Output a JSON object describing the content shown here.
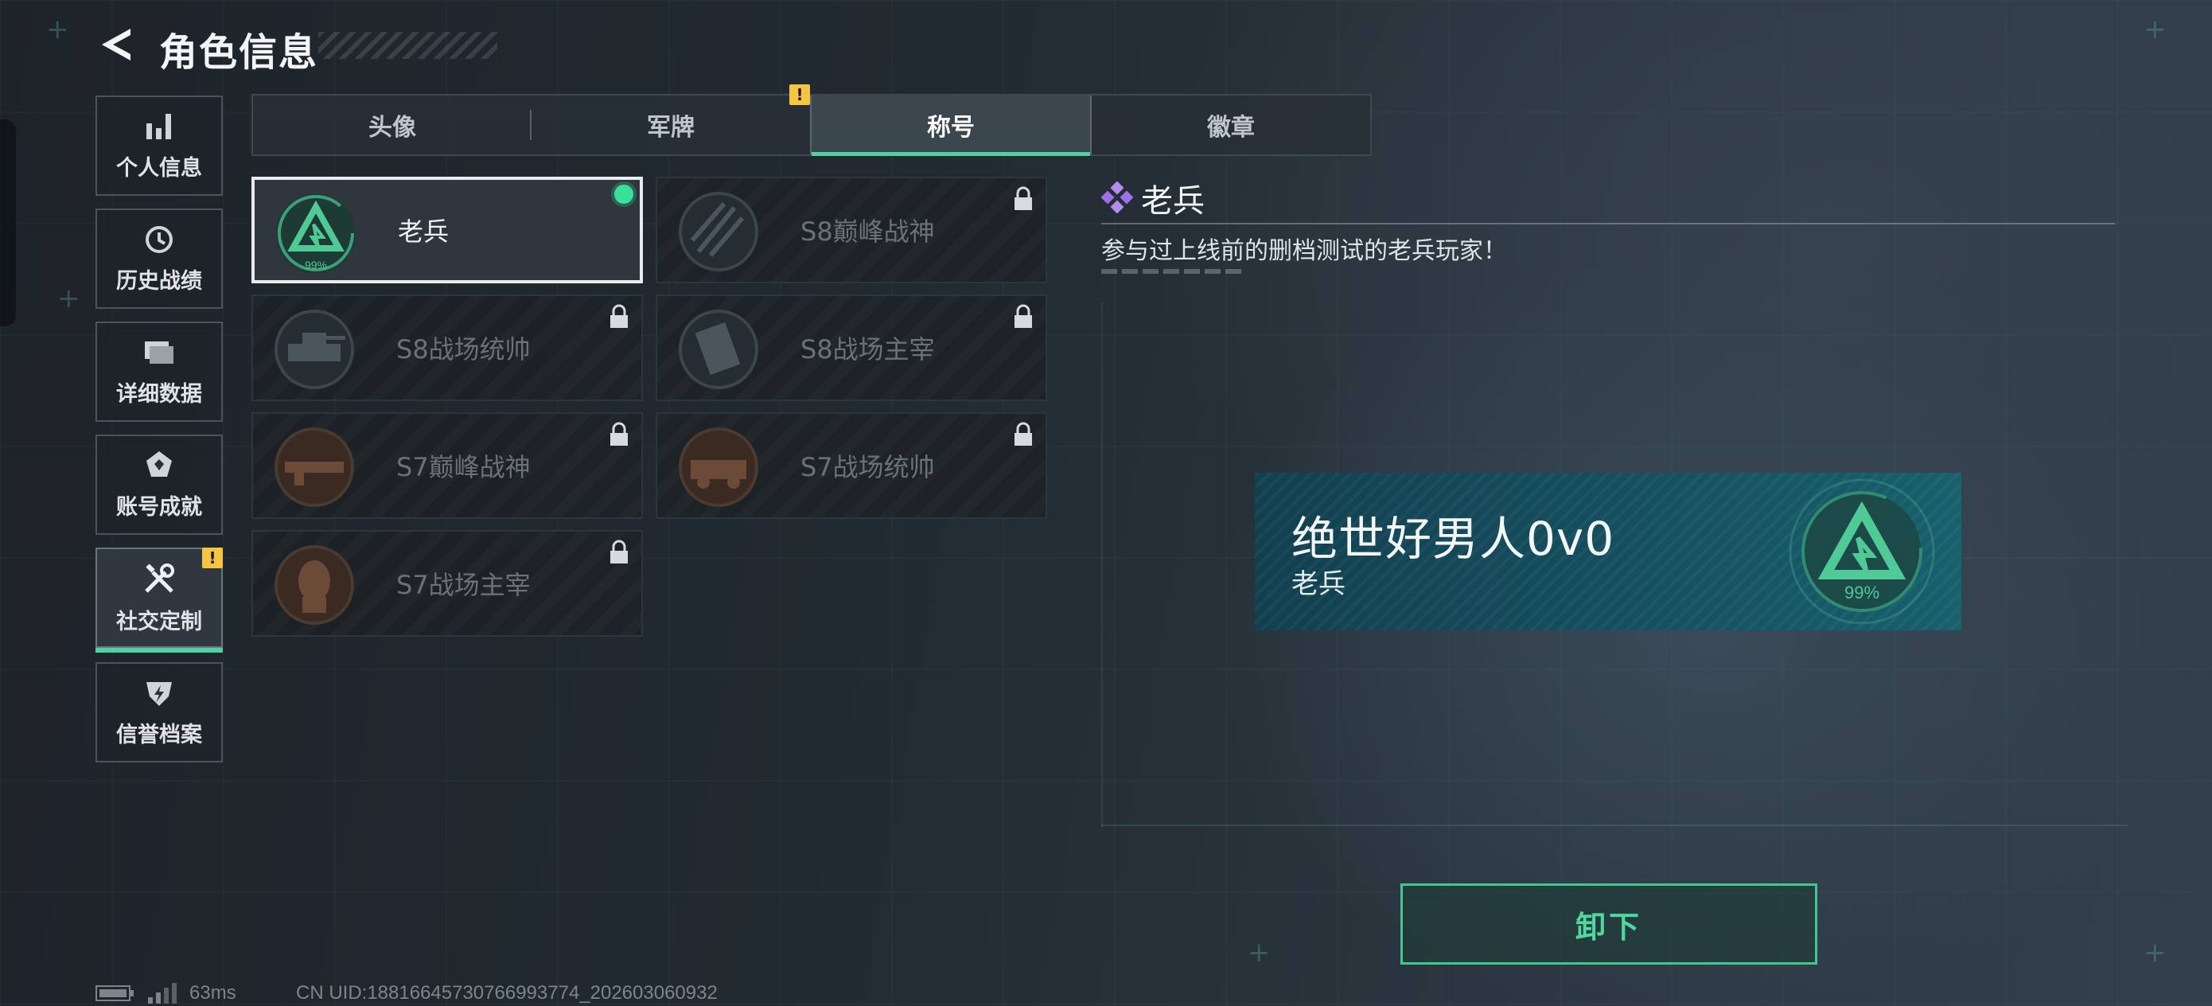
{
  "header": {
    "title": "角色信息"
  },
  "sidebar": {
    "items": [
      {
        "label": "个人信息",
        "icon": "bar-chart-icon",
        "active": false,
        "warning": false
      },
      {
        "label": "历史战绩",
        "icon": "history-icon",
        "active": false,
        "warning": false
      },
      {
        "label": "详细数据",
        "icon": "folders-icon",
        "active": false,
        "warning": false
      },
      {
        "label": "账号成就",
        "icon": "achievement-icon",
        "active": false,
        "warning": false
      },
      {
        "label": "社交定制",
        "icon": "tools-icon",
        "active": true,
        "warning": true
      },
      {
        "label": "信誉档案",
        "icon": "shield-icon",
        "active": false,
        "warning": false
      }
    ]
  },
  "tabs": [
    {
      "label": "头像",
      "active": false,
      "warning": false
    },
    {
      "label": "军牌",
      "active": false,
      "warning": true
    },
    {
      "label": "称号",
      "active": true,
      "warning": false
    },
    {
      "label": "徽章",
      "active": false,
      "warning": false
    }
  ],
  "titles": [
    {
      "name": "老兵",
      "badge_text": "99%",
      "selected": true,
      "locked": false,
      "equipped": true
    },
    {
      "name": "S8巅峰战神",
      "badge_text": "",
      "selected": false,
      "locked": true,
      "equipped": false
    },
    {
      "name": "S8战场统帅",
      "badge_text": "",
      "selected": false,
      "locked": true,
      "equipped": false
    },
    {
      "name": "S8战场主宰",
      "badge_text": "",
      "selected": false,
      "locked": true,
      "equipped": false
    },
    {
      "name": "S7巅峰战神",
      "badge_text": "",
      "selected": false,
      "locked": true,
      "equipped": false
    },
    {
      "name": "S7战场统帅",
      "badge_text": "",
      "selected": false,
      "locked": true,
      "equipped": false
    },
    {
      "name": "S7战场主宰",
      "badge_text": "",
      "selected": false,
      "locked": true,
      "equipped": false
    }
  ],
  "detail": {
    "title": "老兵",
    "description": "参与过上线前的删档测试的老兵玩家！"
  },
  "nameplate": {
    "player_name": "绝世好男人0v0",
    "title": "老兵",
    "badge_text": "99%"
  },
  "actions": {
    "unequip_label": "卸下"
  },
  "status": {
    "ping": "63ms",
    "uid": "CN UID:18816645730766993774_202603060932"
  },
  "colors": {
    "accent": "#4fd1a0",
    "warning": "#f5c542",
    "nameplate": "#155060"
  }
}
